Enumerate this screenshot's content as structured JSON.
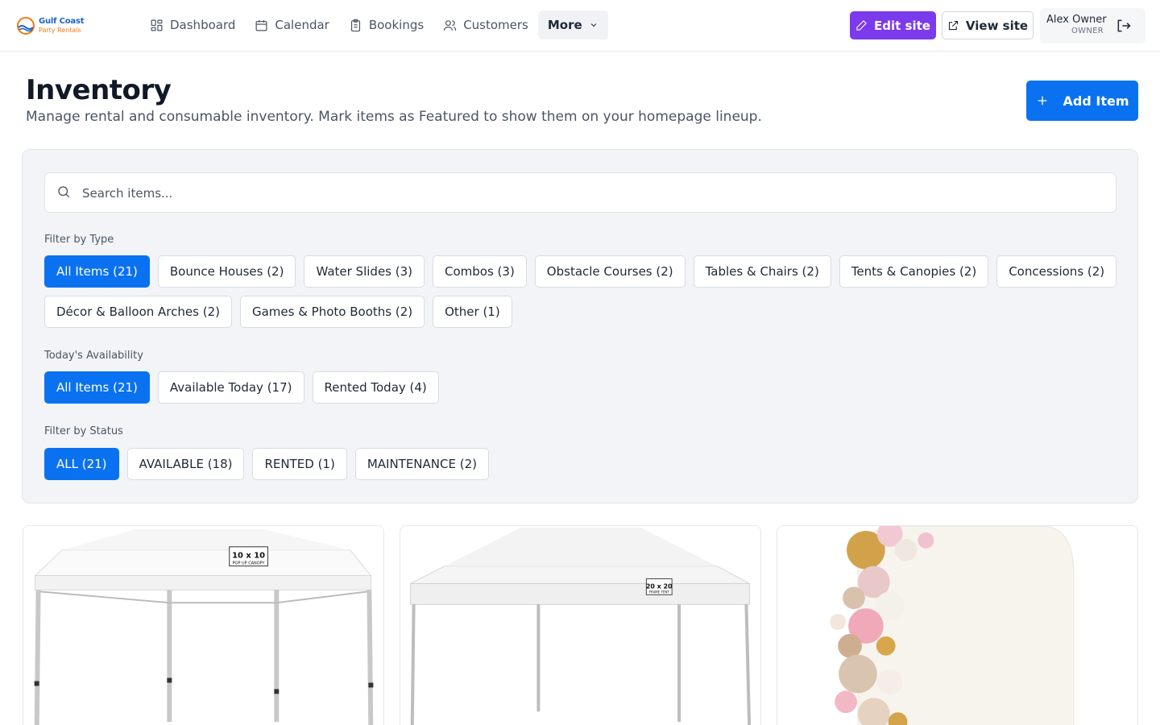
{
  "brand": {
    "line1": "Gulf Coast",
    "line2": "Party Rentals",
    "colors": {
      "primary": "#1e63c6",
      "accent": "#f07b12"
    }
  },
  "nav": {
    "items": [
      {
        "label": "Dashboard",
        "icon": "grid-icon"
      },
      {
        "label": "Calendar",
        "icon": "calendar-icon"
      },
      {
        "label": "Bookings",
        "icon": "clipboard-icon"
      },
      {
        "label": "Customers",
        "icon": "users-icon"
      }
    ],
    "more_label": "More"
  },
  "header_actions": {
    "edit_site": "Edit site",
    "view_site": "View site"
  },
  "user": {
    "name": "Alex Owner",
    "role": "OWNER"
  },
  "page": {
    "title": "Inventory",
    "subtitle": "Manage rental and consumable inventory. Mark items as Featured to show them on your homepage lineup.",
    "add_item": "Add Item"
  },
  "search": {
    "placeholder": "Search items..."
  },
  "filters": {
    "type": {
      "label": "Filter by Type",
      "chips": [
        {
          "label": "All Items (21)",
          "active": true
        },
        {
          "label": "Bounce Houses (2)",
          "active": false
        },
        {
          "label": "Water Slides (3)",
          "active": false
        },
        {
          "label": "Combos (3)",
          "active": false
        },
        {
          "label": "Obstacle Courses (2)",
          "active": false
        },
        {
          "label": "Tables & Chairs (2)",
          "active": false
        },
        {
          "label": "Tents & Canopies (2)",
          "active": false
        },
        {
          "label": "Concessions (2)",
          "active": false
        },
        {
          "label": "Décor & Balloon Arches (2)",
          "active": false
        },
        {
          "label": "Games & Photo Booths (2)",
          "active": false
        },
        {
          "label": "Other (1)",
          "active": false
        }
      ]
    },
    "availability": {
      "label": "Today's Availability",
      "chips": [
        {
          "label": "All Items (21)",
          "active": true
        },
        {
          "label": "Available Today (17)",
          "active": false
        },
        {
          "label": "Rented Today (4)",
          "active": false
        }
      ]
    },
    "status": {
      "label": "Filter by Status",
      "chips": [
        {
          "label": "ALL (21)",
          "active": true
        },
        {
          "label": "AVAILABLE (18)",
          "active": false
        },
        {
          "label": "RENTED (1)",
          "active": false
        },
        {
          "label": "MAINTENANCE (2)",
          "active": false
        }
      ]
    }
  },
  "cards": [
    {
      "image": "tent-canopy-image",
      "sign_line1": "10 x 10",
      "sign_line2": "POP UP CANOPY"
    },
    {
      "image": "frame-tent-image",
      "sign_line1": "20 x 20",
      "sign_line2": "FRAME TENT"
    },
    {
      "image": "balloon-arch-image"
    }
  ],
  "theme": {
    "primary": "#0a72f0",
    "edit": "#7c3aed"
  }
}
